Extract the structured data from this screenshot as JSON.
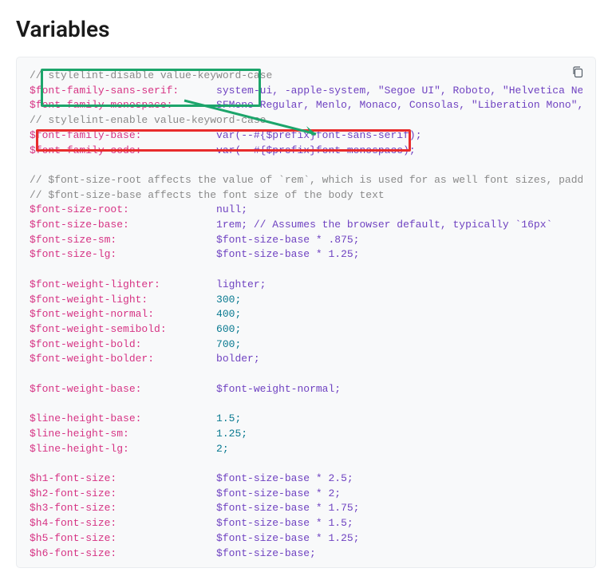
{
  "title": "Variables",
  "code": {
    "l1": "// stylelint-disable value-keyword-case",
    "l2_var": "$font-family-sans-serif:",
    "l2_val": "      system-ui, -apple-system, \"Segoe UI\", Roboto, \"Helvetica Neue\", \"N",
    "l3_var": "$font-family-monospace:",
    "l3_val": "       SFMono-Regular, Menlo, Monaco, Consolas, \"Liberation Mono\", \"Cour",
    "l4": "// stylelint-enable value-keyword-case",
    "l5_var": "$font-family-base:",
    "l5_val": "            var(--#{$prefix}font-sans-serif);",
    "l6_var": "$font-family-code:",
    "l6_val": "            var(--#{$prefix}font-monospace);",
    "l7": "// $font-size-root affects the value of `rem`, which is used for as well font sizes, paddings, a",
    "l8": "// $font-size-base affects the font size of the body text",
    "l9_var": "$font-size-root:",
    "l9_val": "              null;",
    "l10_var": "$font-size-base:",
    "l10_val": "              1rem; // Assumes the browser default, typically `16px`",
    "l11_var": "$font-size-sm:",
    "l11_val": "                $font-size-base * .875;",
    "l12_var": "$font-size-lg:",
    "l12_val": "                $font-size-base * 1.25;",
    "l13_var": "$font-weight-lighter:",
    "l13_val": "         lighter;",
    "l14_var": "$font-weight-light:",
    "l14_val": "           300;",
    "l15_var": "$font-weight-normal:",
    "l15_val": "          400;",
    "l16_var": "$font-weight-semibold:",
    "l16_val": "        600;",
    "l17_var": "$font-weight-bold:",
    "l17_val": "            700;",
    "l18_var": "$font-weight-bolder:",
    "l18_val": "          bolder;",
    "l19_var": "$font-weight-base:",
    "l19_val": "            $font-weight-normal;",
    "l20_var": "$line-height-base:",
    "l20_val": "            1.5;",
    "l21_var": "$line-height-sm:",
    "l21_val": "              1.25;",
    "l22_var": "$line-height-lg:",
    "l22_val": "              2;",
    "l23_var": "$h1-font-size:",
    "l23_val": "                $font-size-base * 2.5;",
    "l24_var": "$h2-font-size:",
    "l24_val": "                $font-size-base * 2;",
    "l25_var": "$h3-font-size:",
    "l25_val": "                $font-size-base * 1.75;",
    "l26_var": "$h4-font-size:",
    "l26_val": "                $font-size-base * 1.5;",
    "l27_var": "$h5-font-size:",
    "l27_val": "                $font-size-base * 1.25;",
    "l28_var": "$h6-font-size:",
    "l28_val": "                $font-size-base;"
  }
}
